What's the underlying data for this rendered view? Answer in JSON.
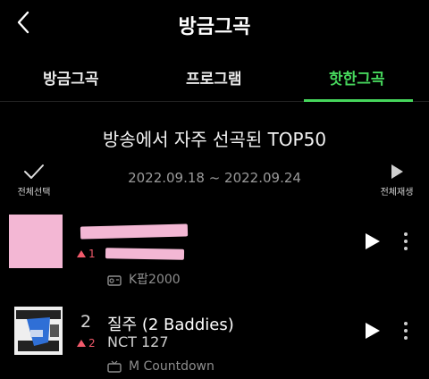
{
  "header": {
    "title": "방금그곡"
  },
  "tabs": [
    {
      "label": "방금그곡"
    },
    {
      "label": "프로그램"
    },
    {
      "label": "핫한그곡",
      "active": true
    }
  ],
  "section": {
    "title": "방송에서 자주 선곡된 TOP50",
    "select_all_label": "전체선택",
    "date_range": "2022.09.18 ~ 2022.09.24",
    "play_all_label": "전체재생"
  },
  "colors": {
    "accent": "#46d65c",
    "rank_up": "#f15a6b",
    "redaction": "#f3b7d4"
  },
  "songs": [
    {
      "rank": "",
      "change": "1",
      "title": "",
      "artist": "",
      "program": "K팝2000",
      "program_icon": "radio-icon"
    },
    {
      "rank": "2",
      "change": "2",
      "title": "질주 (2 Baddies)",
      "artist": "NCT 127",
      "program": "M Countdown",
      "program_icon": "tv-icon"
    }
  ]
}
